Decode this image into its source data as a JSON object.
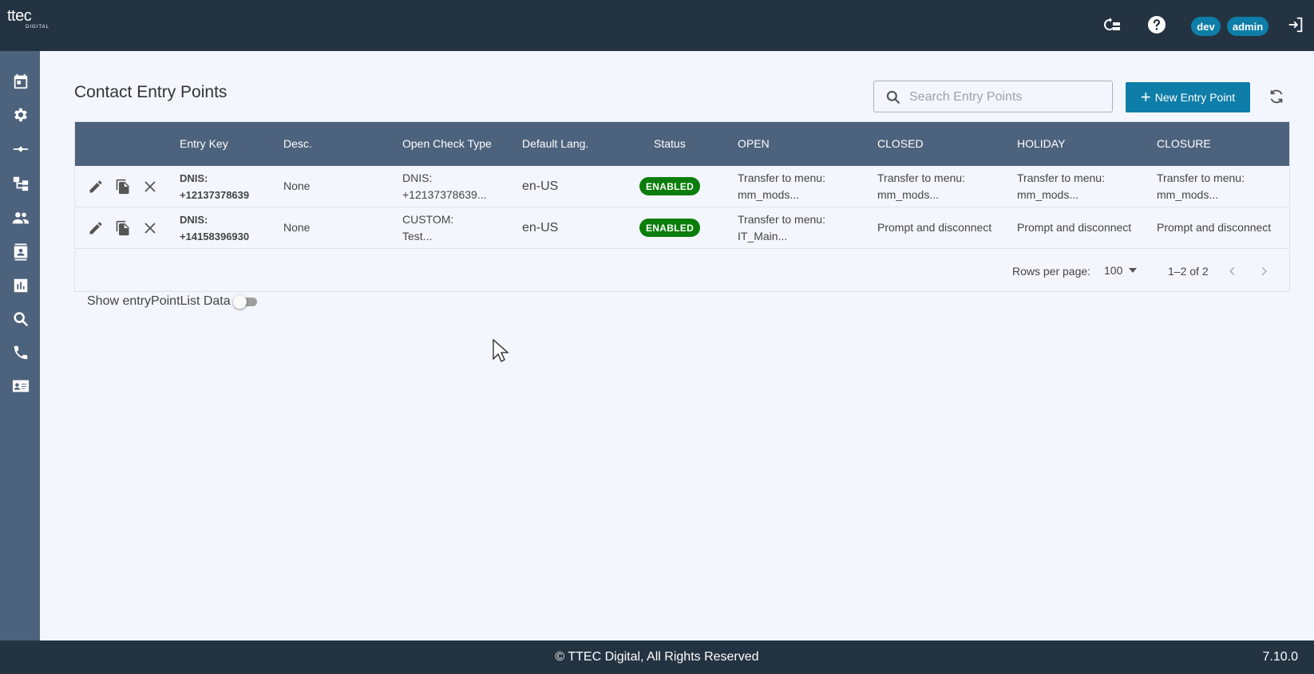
{
  "header": {
    "logo_text": "ttec",
    "logo_sub": "DIGITAL",
    "icons": [
      "switch-tenant-icon",
      "help-icon",
      "logout-icon"
    ],
    "env_chip": "dev",
    "user_chip": "admin"
  },
  "sidebar": {
    "items": [
      "calendar-icon",
      "settings-icon",
      "transfer-icon",
      "flow-icon",
      "people-icon",
      "contacts-icon",
      "reports-icon",
      "search-icon",
      "phone-icon",
      "contact-card-icon"
    ]
  },
  "page": {
    "title": "Contact Entry Points",
    "search_placeholder": "Search Entry Points",
    "new_button": "New Entry Point"
  },
  "table": {
    "columns": [
      "Entry Key",
      "Desc.",
      "Open Check Type",
      "Default Lang.",
      "Status",
      "OPEN",
      "CLOSED",
      "HOLIDAY",
      "CLOSURE"
    ],
    "rows": [
      {
        "entry_key_1": "DNIS:",
        "entry_key_2": "+12137378639",
        "desc": "None",
        "open_check_1": "DNIS:",
        "open_check_2": "+12137378639...",
        "lang": "en-US",
        "status": "ENABLED",
        "open_1": "Transfer to menu:",
        "open_2": "mm_mods...",
        "closed_1": "Transfer to menu:",
        "closed_2": "mm_mods...",
        "holiday_1": "Transfer to menu:",
        "holiday_2": "mm_mods...",
        "closure_1": "Transfer to menu:",
        "closure_2": "mm_mods..."
      },
      {
        "entry_key_1": "DNIS:",
        "entry_key_2": "+14158396930",
        "desc": "None",
        "open_check_1": "CUSTOM:",
        "open_check_2": "Test...",
        "lang": "en-US",
        "status": "ENABLED",
        "open_1": "Transfer to menu:",
        "open_2": "IT_Main...",
        "closed": "Prompt and disconnect",
        "holiday": "Prompt and disconnect",
        "closure": "Prompt and disconnect"
      }
    ],
    "rows_per_page_label": "Rows per page:",
    "rows_per_page_value": "100",
    "range": "1–2 of 2"
  },
  "toggle": {
    "label": "Show entryPointList Data",
    "on": false
  },
  "footer": {
    "copyright": "© TTEC Digital, All Rights Reserved",
    "version": "7.10.0"
  },
  "colors": {
    "topbar": "#243342",
    "sidebar": "#4d627c",
    "accent": "#0e7ea8",
    "enabled": "#0a7d0a",
    "background": "#f3f7fd"
  }
}
